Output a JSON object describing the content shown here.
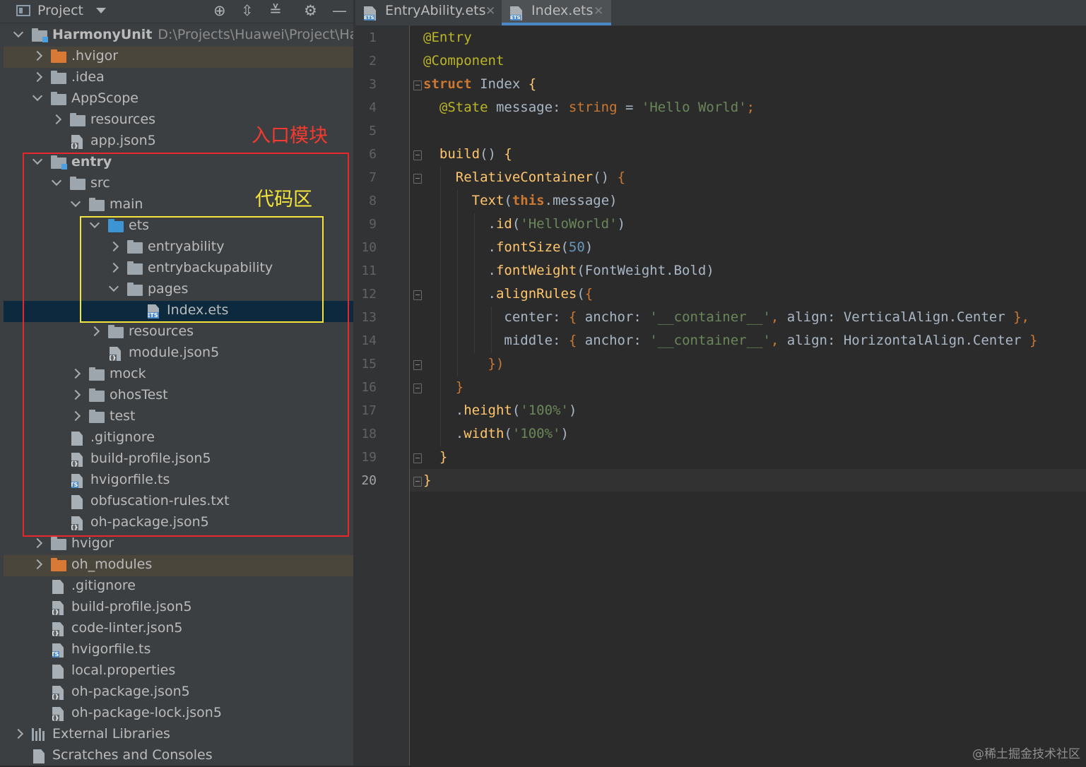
{
  "project_panel": {
    "title": "Project",
    "toolbar_icons": [
      "locate-icon",
      "expand-all-icon",
      "collapse-all-icon",
      "gear-icon",
      "hide-icon"
    ]
  },
  "tree": [
    {
      "label": "HarmonyUnit",
      "path": "D:\\Projects\\Huawei\\Project\\Harmo",
      "indent": 0,
      "arrow": "down",
      "icon": "folder-module",
      "bold": true
    },
    {
      "label": ".hvigor",
      "indent": 1,
      "arrow": "right",
      "icon": "folder-orange",
      "hl": "amber"
    },
    {
      "label": ".idea",
      "indent": 1,
      "arrow": "right",
      "icon": "folder"
    },
    {
      "label": "AppScope",
      "indent": 1,
      "arrow": "down",
      "icon": "folder"
    },
    {
      "label": "resources",
      "indent": 2,
      "arrow": "right",
      "icon": "folder"
    },
    {
      "label": "app.json5",
      "indent": 2,
      "arrow": "",
      "icon": "file-json"
    },
    {
      "label": "entry",
      "indent": 1,
      "arrow": "down",
      "icon": "folder-module",
      "bold": true
    },
    {
      "label": "src",
      "indent": 2,
      "arrow": "down",
      "icon": "folder"
    },
    {
      "label": "main",
      "indent": 3,
      "arrow": "down",
      "icon": "folder"
    },
    {
      "label": "ets",
      "indent": 4,
      "arrow": "down",
      "icon": "folder-blue"
    },
    {
      "label": "entryability",
      "indent": 5,
      "arrow": "right",
      "icon": "folder"
    },
    {
      "label": "entrybackupability",
      "indent": 5,
      "arrow": "right",
      "icon": "folder"
    },
    {
      "label": "pages",
      "indent": 5,
      "arrow": "down",
      "icon": "folder"
    },
    {
      "label": "Index.ets",
      "indent": 6,
      "arrow": "",
      "icon": "file-ets",
      "hl": "sel"
    },
    {
      "label": "resources",
      "indent": 4,
      "arrow": "right",
      "icon": "folder"
    },
    {
      "label": "module.json5",
      "indent": 4,
      "arrow": "",
      "icon": "file-json"
    },
    {
      "label": "mock",
      "indent": 3,
      "arrow": "right",
      "icon": "folder"
    },
    {
      "label": "ohosTest",
      "indent": 3,
      "arrow": "right",
      "icon": "folder"
    },
    {
      "label": "test",
      "indent": 3,
      "arrow": "right",
      "icon": "folder"
    },
    {
      "label": ".gitignore",
      "indent": 2,
      "arrow": "",
      "icon": "file"
    },
    {
      "label": "build-profile.json5",
      "indent": 2,
      "arrow": "",
      "icon": "file-json"
    },
    {
      "label": "hvigorfile.ts",
      "indent": 2,
      "arrow": "",
      "icon": "file-ts"
    },
    {
      "label": "obfuscation-rules.txt",
      "indent": 2,
      "arrow": "",
      "icon": "file"
    },
    {
      "label": "oh-package.json5",
      "indent": 2,
      "arrow": "",
      "icon": "file-json"
    },
    {
      "label": "hvigor",
      "indent": 1,
      "arrow": "right",
      "icon": "folder"
    },
    {
      "label": "oh_modules",
      "indent": 1,
      "arrow": "right",
      "icon": "folder-orange",
      "hl": "amber"
    },
    {
      "label": ".gitignore",
      "indent": 1,
      "arrow": "",
      "icon": "file"
    },
    {
      "label": "build-profile.json5",
      "indent": 1,
      "arrow": "",
      "icon": "file-json"
    },
    {
      "label": "code-linter.json5",
      "indent": 1,
      "arrow": "",
      "icon": "file-json"
    },
    {
      "label": "hvigorfile.ts",
      "indent": 1,
      "arrow": "",
      "icon": "file-ts"
    },
    {
      "label": "local.properties",
      "indent": 1,
      "arrow": "",
      "icon": "file"
    },
    {
      "label": "oh-package.json5",
      "indent": 1,
      "arrow": "",
      "icon": "file-json"
    },
    {
      "label": "oh-package-lock.json5",
      "indent": 1,
      "arrow": "",
      "icon": "file-json"
    },
    {
      "label": "External Libraries",
      "indent": 0,
      "arrow": "right",
      "icon": "library"
    },
    {
      "label": "Scratches and Consoles",
      "indent": 0,
      "arrow": "",
      "icon": "scratch"
    }
  ],
  "annotations": {
    "entry_module": "入口模块",
    "code_area": "代码区"
  },
  "tabs": [
    {
      "label": "EntryAbility.ets",
      "tag": "ETS",
      "active": false
    },
    {
      "label": "Index.ets",
      "tag": "ETS",
      "active": true
    }
  ],
  "editor": {
    "line_numbers": [
      "1",
      "2",
      "3",
      "4",
      "5",
      "6",
      "7",
      "8",
      "9",
      "10",
      "11",
      "12",
      "13",
      "14",
      "15",
      "16",
      "17",
      "18",
      "19",
      "20"
    ],
    "current_line": "20",
    "code": [
      [
        [
          "ann",
          "@Entry"
        ]
      ],
      [
        [
          "ann",
          "@Component"
        ]
      ],
      [
        [
          "kw",
          "struct "
        ],
        [
          "typ",
          "Index "
        ],
        [
          "fn",
          "{"
        ]
      ],
      [
        [
          "typ",
          "  "
        ],
        [
          "ann",
          "@State "
        ],
        [
          "typ",
          "message: "
        ],
        [
          "k",
          "string"
        ],
        [
          "typ",
          " = "
        ],
        [
          "str",
          "'Hello World'"
        ],
        [
          "k",
          ";"
        ]
      ],
      [],
      [
        [
          "typ",
          "  "
        ],
        [
          "fn",
          "build"
        ],
        [
          "typ",
          "() "
        ],
        [
          "fn",
          "{"
        ]
      ],
      [
        [
          "typ",
          "    "
        ],
        [
          "fn",
          "RelativeContainer"
        ],
        [
          "typ",
          "() "
        ],
        [
          "k",
          "{"
        ]
      ],
      [
        [
          "typ",
          "      "
        ],
        [
          "fn",
          "Text"
        ],
        [
          "typ",
          "("
        ],
        [
          "kw",
          "this"
        ],
        [
          "typ",
          ".message)"
        ]
      ],
      [
        [
          "typ",
          "        ."
        ],
        [
          "fn",
          "id"
        ],
        [
          "typ",
          "("
        ],
        [
          "str",
          "'HelloWorld'"
        ],
        [
          "typ",
          ")"
        ]
      ],
      [
        [
          "typ",
          "        ."
        ],
        [
          "fn",
          "fontSize"
        ],
        [
          "typ",
          "("
        ],
        [
          "num",
          "50"
        ],
        [
          "typ",
          ")"
        ]
      ],
      [
        [
          "typ",
          "        ."
        ],
        [
          "fn",
          "fontWeight"
        ],
        [
          "typ",
          "(FontWeight.Bold)"
        ]
      ],
      [
        [
          "typ",
          "        ."
        ],
        [
          "fn",
          "alignRules"
        ],
        [
          "typ",
          "("
        ],
        [
          "k",
          "{"
        ]
      ],
      [
        [
          "typ",
          "          center: "
        ],
        [
          "k",
          "{ "
        ],
        [
          "typ",
          "anchor: "
        ],
        [
          "str",
          "'__container__'"
        ],
        [
          "k",
          ", "
        ],
        [
          "typ",
          "align: VerticalAlign.Center "
        ],
        [
          "k",
          "},"
        ]
      ],
      [
        [
          "typ",
          "          middle: "
        ],
        [
          "k",
          "{ "
        ],
        [
          "typ",
          "anchor: "
        ],
        [
          "str",
          "'__container__'"
        ],
        [
          "k",
          ", "
        ],
        [
          "typ",
          "align: HorizontalAlign.Center "
        ],
        [
          "k",
          "}"
        ]
      ],
      [
        [
          "typ",
          "        "
        ],
        [
          "k",
          "})"
        ]
      ],
      [
        [
          "typ",
          "    "
        ],
        [
          "k",
          "}"
        ]
      ],
      [
        [
          "typ",
          "    ."
        ],
        [
          "fn",
          "height"
        ],
        [
          "typ",
          "("
        ],
        [
          "str",
          "'100%'"
        ],
        [
          "typ",
          ")"
        ]
      ],
      [
        [
          "typ",
          "    ."
        ],
        [
          "fn",
          "width"
        ],
        [
          "typ",
          "("
        ],
        [
          "str",
          "'100%'"
        ],
        [
          "typ",
          ")"
        ]
      ],
      [
        [
          "typ",
          "  "
        ],
        [
          "fn",
          "}"
        ]
      ],
      [
        [
          "fn",
          "}"
        ]
      ]
    ]
  },
  "watermark": "@稀土掘金技术社区",
  "colors": {
    "panel_bg": "#3c3f41",
    "editor_bg": "#2b2b2b",
    "selection": "#0d293e",
    "red_box": "#e8262e",
    "yellow_box": "#f3e33b"
  }
}
